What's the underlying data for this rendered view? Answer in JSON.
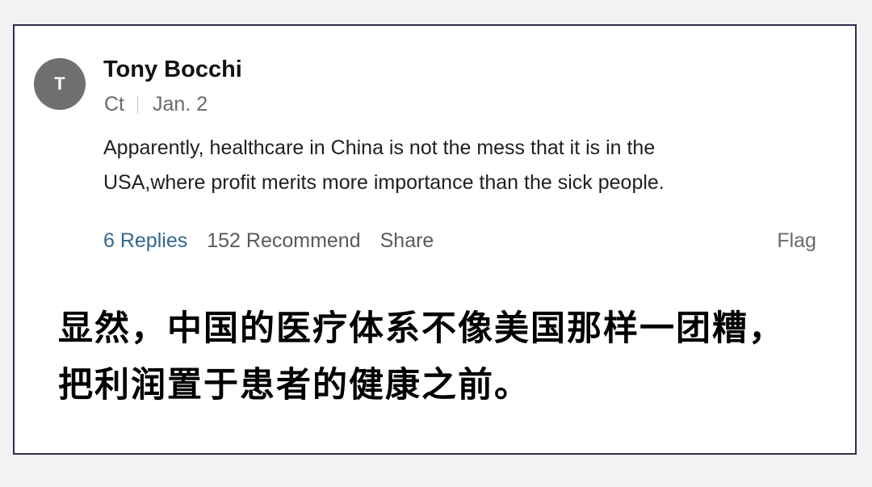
{
  "comment": {
    "avatar_initial": "T",
    "author": "Tony Bocchi",
    "location": "Ct",
    "date": "Jan. 2",
    "text_lines": [
      "Apparently, healthcare in China is not the mess that it is in the",
      "USA,where profit  merits more importance than the sick people."
    ],
    "actions": {
      "replies": "6 Replies",
      "recommend": "152 Recommend",
      "share": "Share",
      "flag": "Flag"
    }
  },
  "translation": {
    "lines": [
      "显然，中国的医疗体系不像美国那样一团糟，",
      "把利润置于患者的健康之前。"
    ]
  },
  "colors": {
    "avatar_bg": "#6f6f6f",
    "link": "#326891",
    "border": "#2b2f4a"
  }
}
